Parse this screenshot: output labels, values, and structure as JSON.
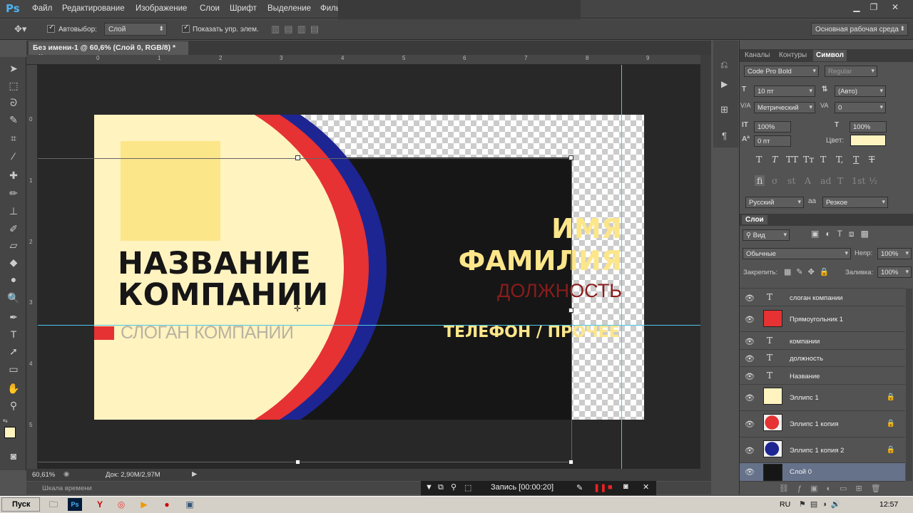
{
  "app": {
    "logo": "Ps"
  },
  "menu": [
    "Файл",
    "Редактирование",
    "Изображение",
    "Слои",
    "Шрифт",
    "Выделение",
    "Филь"
  ],
  "options": {
    "autoselect_label": "Автовыбор:",
    "autoselect_value": "Слой",
    "show_controls_label": "Показать упр. элем.",
    "workspace": "Основная рабочая среда"
  },
  "document": {
    "tab_title": "Без имени-1 @ 60,6% (Слой 0, RGB/8) *",
    "tab_close": "×",
    "ruler_top": [
      "0",
      "1",
      "2",
      "3",
      "4",
      "5",
      "6",
      "7",
      "8",
      "9"
    ],
    "ruler_left": [
      "0",
      "1",
      "2",
      "3",
      "4",
      "5"
    ],
    "zoom": "60,61%",
    "doc_size": "Док: 2,90M/2,97M",
    "timeline_label": "Шкала времени"
  },
  "card": {
    "company_line1": "НАЗВАНИЕ",
    "company_line2": "КОМПАНИИ",
    "slogan": "СЛОГАН КОМПАНИИ",
    "first_name": "ИМЯ",
    "last_name": "ФАМИЛИЯ",
    "position": "ДОЛЖНОСТЬ",
    "phone": "ТЕЛЕФОН / ПРОЧЕЕ",
    "colors": {
      "cream": "#fff3c0",
      "red": "#e63232",
      "blue": "#1d2593",
      "dark": "#161616",
      "yellow_box": "#fce68a",
      "slogan": "#b8b3a0",
      "position": "#8a1c1c"
    }
  },
  "record": {
    "label": "Запись [00:00:20]"
  },
  "panel": {
    "tabs": [
      "Каналы",
      "Контуры",
      "Символ"
    ],
    "font_family": "Code Pro Bold",
    "font_style": "Regular",
    "font_size": "10 пт",
    "leading": "(Авто)",
    "kerning": "Метрический",
    "tracking": "0",
    "vscale": "100%",
    "hscale": "100%",
    "baseline": "0 пт",
    "color_label": "Цвет:",
    "color_value": "#fff3c0",
    "glyphs_row1": [
      "T",
      "T",
      "TT",
      "Tт",
      "T",
      "T,",
      "T",
      "T"
    ],
    "glyphs_row2": [
      "fi",
      "σ",
      "st",
      "A",
      "ad",
      "T",
      "1st",
      "½"
    ],
    "language": "Русский",
    "aa_label": "aa",
    "antialias": "Резкое"
  },
  "layers_panel": {
    "title": "Слои",
    "filter": "Вид",
    "blend_mode": "Обычные",
    "opacity_label": "Непр:",
    "opacity": "100%",
    "lock_label": "Закрепить:",
    "fill_label": "Заливка:",
    "fill": "100%",
    "layers": [
      {
        "name": "слоган компании",
        "type": "text"
      },
      {
        "name": "Прямоугольник 1",
        "type": "shape",
        "thumb": "#e63232"
      },
      {
        "name": "компании",
        "type": "text"
      },
      {
        "name": "должность",
        "type": "text"
      },
      {
        "name": "Название",
        "type": "text"
      },
      {
        "name": "Эллипс 1",
        "type": "shape",
        "thumb": "#fff3c0",
        "locked": true
      },
      {
        "name": "Эллипс 1 копия",
        "type": "shape",
        "thumb": "#e63232",
        "locked": true
      },
      {
        "name": "Эллипс 1 копия 2",
        "type": "shape",
        "thumb": "#1d2593",
        "locked": true
      },
      {
        "name": "Слой 0",
        "type": "pixel",
        "thumb": "#161616",
        "selected": true
      }
    ]
  },
  "taskbar": {
    "start": "Пуск",
    "lang": "RU",
    "time": "12:57"
  }
}
